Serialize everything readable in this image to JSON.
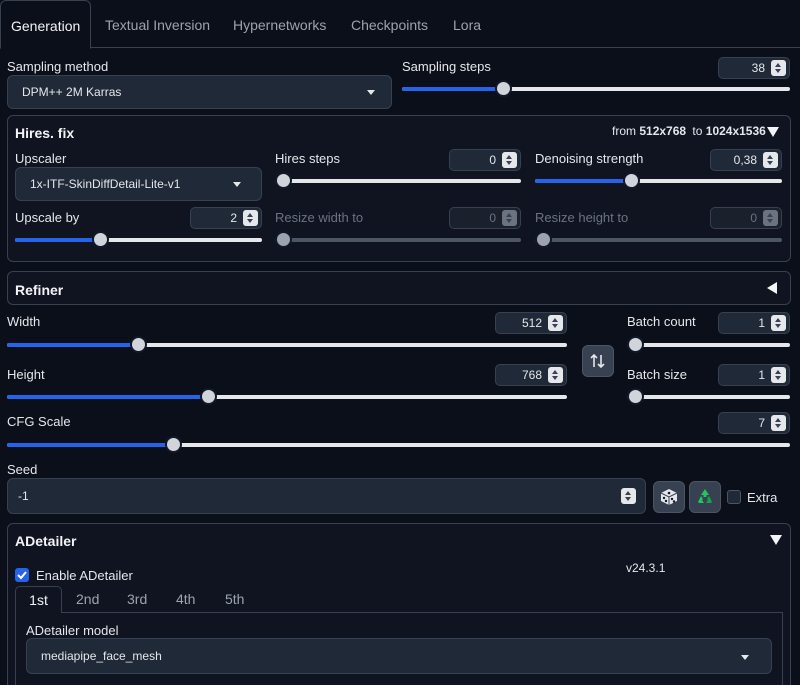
{
  "tabs": [
    {
      "label": "Generation",
      "active": true
    },
    {
      "label": "Textual Inversion",
      "active": false
    },
    {
      "label": "Hypernetworks",
      "active": false
    },
    {
      "label": "Checkpoints",
      "active": false
    },
    {
      "label": "Lora",
      "active": false
    }
  ],
  "sampling": {
    "method_label": "Sampling method",
    "method_value": "DPM++ 2M Karras",
    "steps_label": "Sampling steps",
    "steps_value": "38"
  },
  "hires": {
    "title": "Hires. fix",
    "from_text": "from",
    "from_size": "512x768",
    "to_text": "to",
    "to_size": "1024x1536",
    "upscaler_label": "Upscaler",
    "upscaler_value": "1x-ITF-SkinDiffDetail-Lite-v1",
    "hires_steps_label": "Hires steps",
    "hires_steps_value": "0",
    "denoise_label": "Denoising strength",
    "denoise_value": "0,38",
    "upscale_by_label": "Upscale by",
    "upscale_by_value": "2",
    "resize_w_label": "Resize width to",
    "resize_w_value": "0",
    "resize_h_label": "Resize height to",
    "resize_h_value": "0"
  },
  "refiner": {
    "title": "Refiner"
  },
  "size": {
    "width_label": "Width",
    "width_value": "512",
    "height_label": "Height",
    "height_value": "768",
    "batch_count_label": "Batch count",
    "batch_count_value": "1",
    "batch_size_label": "Batch size",
    "batch_size_value": "1"
  },
  "cfg": {
    "label": "CFG Scale",
    "value": "7"
  },
  "seed": {
    "label": "Seed",
    "value": "-1",
    "extra_label": "Extra"
  },
  "adetailer": {
    "title": "ADetailer",
    "enable_label": "Enable ADetailer",
    "version": "v24.3.1",
    "tabs": [
      "1st",
      "2nd",
      "3rd",
      "4th",
      "5th"
    ],
    "model_label": "ADetailer model",
    "model_value": "mediapipe_face_mesh"
  },
  "colors": {
    "background": "#0b0f19",
    "accent": "#2563eb",
    "border": "#374151",
    "recycle_icon": "#22c55e"
  },
  "icons": {
    "swap": "swap-dimensions-icon",
    "dice": "dice-icon",
    "recycle": "recycle-icon",
    "check": "checkmark-icon"
  }
}
